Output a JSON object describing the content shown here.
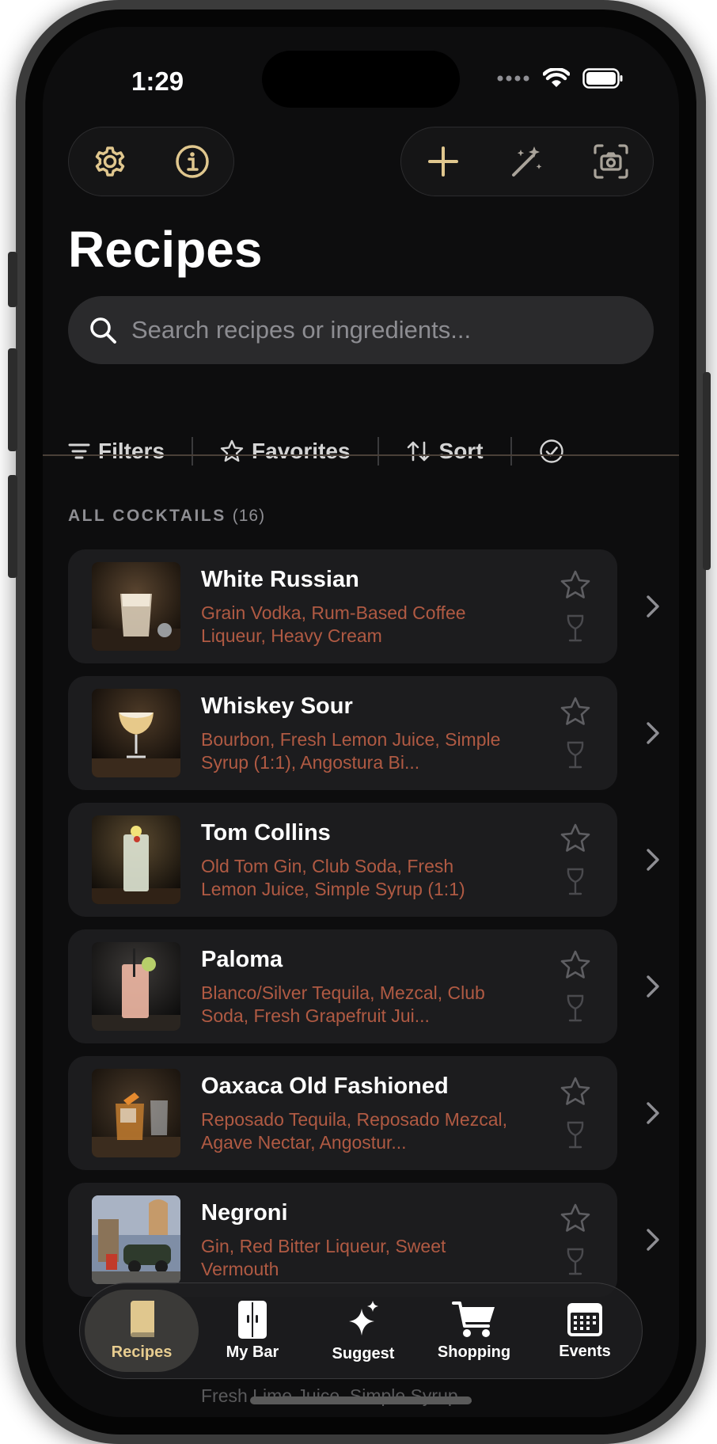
{
  "status": {
    "time": "1:29"
  },
  "toolbar": {
    "left": [
      {
        "icon": "gear-icon"
      },
      {
        "icon": "info-icon"
      }
    ],
    "right": [
      {
        "icon": "plus-icon"
      },
      {
        "icon": "magic-wand-icon"
      },
      {
        "icon": "camera-scan-icon"
      }
    ]
  },
  "page": {
    "title": "Recipes"
  },
  "search": {
    "placeholder": "Search recipes or ingredients..."
  },
  "filters": {
    "filters_label": "Filters",
    "favorites_label": "Favorites",
    "sort_label": "Sort"
  },
  "section": {
    "title": "ALL COCKTAILS",
    "count": "(16)"
  },
  "cocktails": [
    {
      "name": "White Russian",
      "ingredients": "Grain Vodka, Rum-Based Coffee Liqueur, Heavy Cream"
    },
    {
      "name": "Whiskey Sour",
      "ingredients": "Bourbon, Fresh Lemon Juice, Simple Syrup (1:1), Angostura Bi..."
    },
    {
      "name": "Tom Collins",
      "ingredients": "Old Tom Gin, Club Soda, Fresh Lemon Juice, Simple Syrup (1:1)"
    },
    {
      "name": "Paloma",
      "ingredients": "Blanco/Silver Tequila, Mezcal, Club Soda, Fresh Grapefruit Jui..."
    },
    {
      "name": "Oaxaca Old Fashioned",
      "ingredients": "Reposado Tequila, Reposado Mezcal, Agave Nectar, Angostur..."
    },
    {
      "name": "Negroni",
      "ingredients": "Gin, Red Bitter Liqueur, Sweet Vermouth"
    }
  ],
  "partial_row": {
    "ingredients": "Fresh Lime Juice, Simple Syrup..."
  },
  "tabs": [
    {
      "label": "Recipes",
      "icon": "book-icon",
      "active": true
    },
    {
      "label": "My Bar",
      "icon": "cabinet-icon",
      "active": false
    },
    {
      "label": "Suggest",
      "icon": "sparkles-icon",
      "active": false
    },
    {
      "label": "Shopping",
      "icon": "cart-icon",
      "active": false
    },
    {
      "label": "Events",
      "icon": "calendar-icon",
      "active": false
    }
  ],
  "colors": {
    "accent": "#e0c78e",
    "ingredient": "#b05a43",
    "card": "#1c1c1e",
    "background": "#0d0d0e"
  }
}
